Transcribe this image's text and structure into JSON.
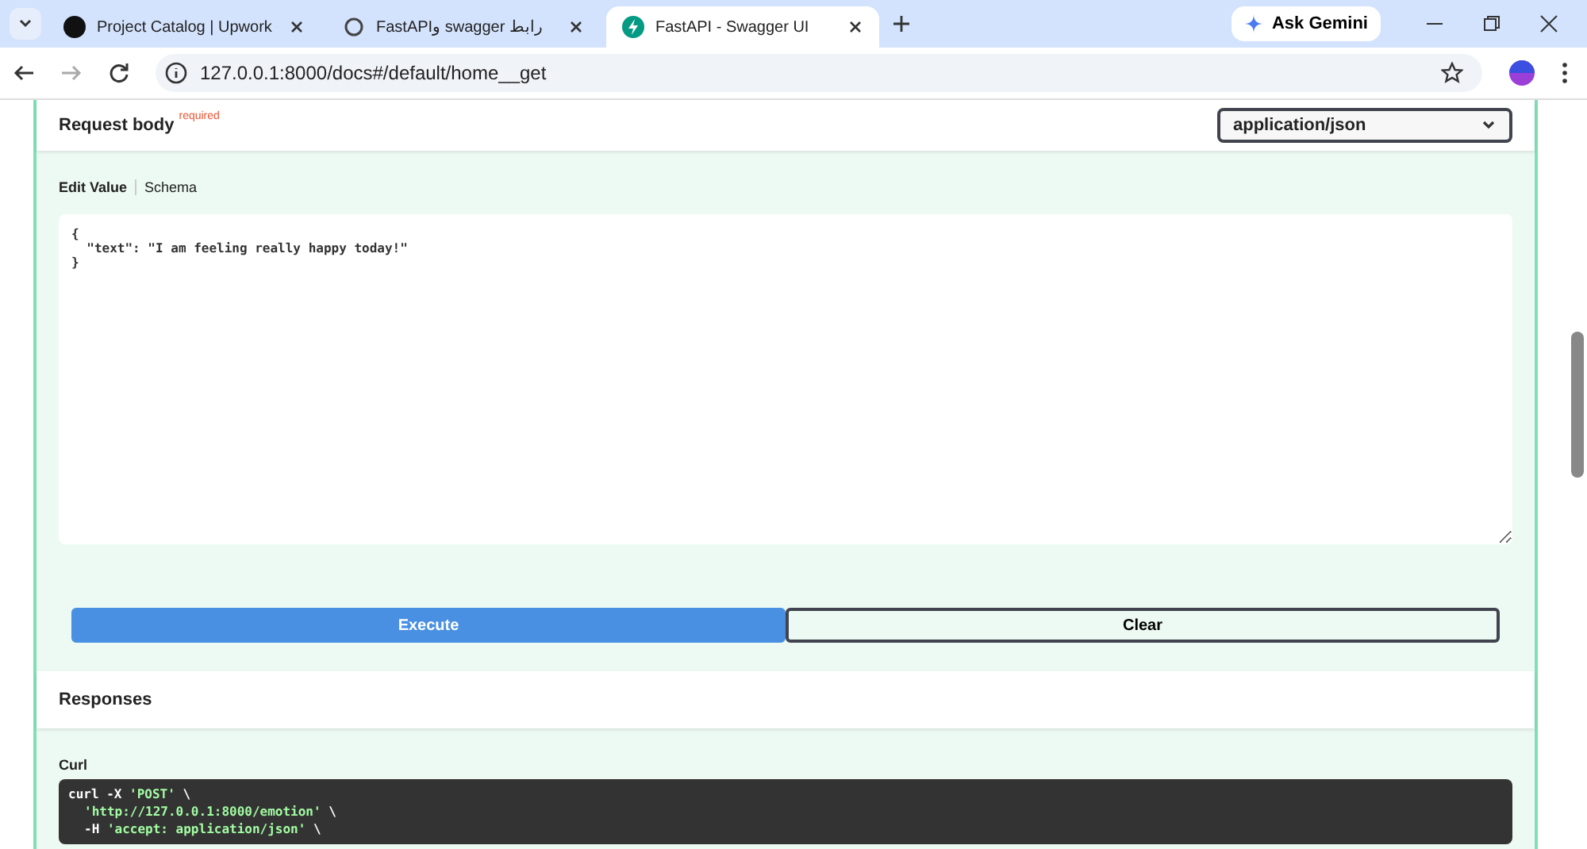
{
  "browser": {
    "tabs": [
      {
        "title": "Project Catalog | Upwork",
        "selected": false
      },
      {
        "title": "FastAPI‏و swagger رابط",
        "selected": false
      },
      {
        "title": "FastAPI - Swagger UI",
        "selected": true
      }
    ],
    "gemini": "Ask Gemini",
    "url": "127.0.0.1:8000/docs#/default/home__get"
  },
  "request_body": {
    "title": "Request body",
    "required": "required",
    "content_type": "application/json",
    "views": [
      {
        "label": "Edit Value",
        "selected": true
      },
      {
        "label": "Schema",
        "selected": false
      }
    ],
    "value": "{\n  \"text\": \"I am feeling really happy today!\"\n}"
  },
  "buttons": [
    {
      "label": "Execute",
      "kind": "primary"
    },
    {
      "label": "Clear",
      "kind": "secondary"
    }
  ],
  "responses": {
    "title": "Responses",
    "curl_label": "Curl",
    "curl_lines": [
      {
        "parts": [
          {
            "t": "curl -X ",
            "kind": "plain"
          },
          {
            "t": "'POST'",
            "kind": "str"
          },
          {
            "t": " \\",
            "kind": "plain"
          }
        ]
      },
      {
        "parts": [
          {
            "t": "'http://127.0.0.1:8000/emotion'",
            "kind": "str"
          },
          {
            "t": " \\",
            "kind": "plain"
          }
        ]
      },
      {
        "parts": [
          {
            "t": "-H ",
            "kind": "plain"
          },
          {
            "t": "'accept: application/json'",
            "kind": "str"
          },
          {
            "t": " \\",
            "kind": "plain"
          }
        ]
      }
    ]
  }
}
